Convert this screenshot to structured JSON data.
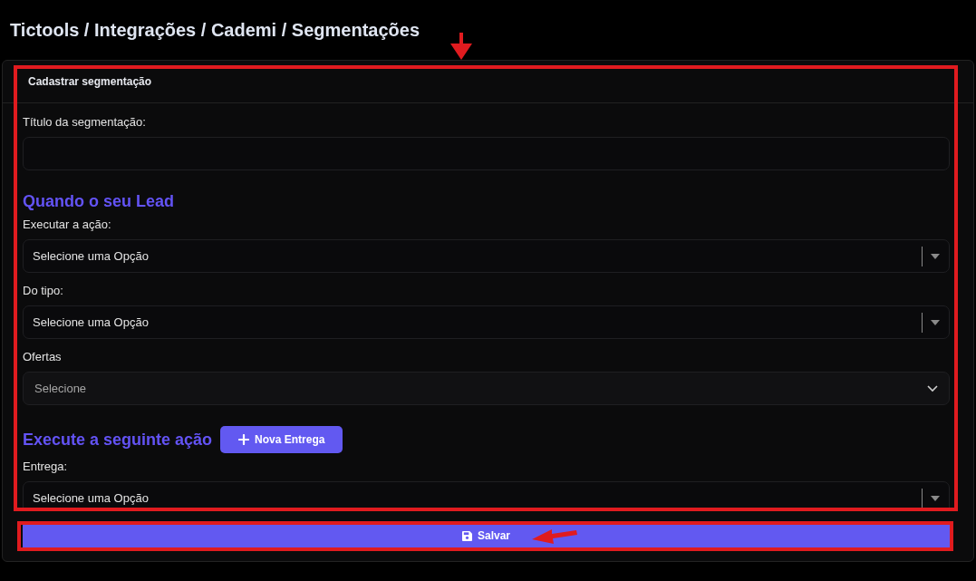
{
  "breadcrumb": "Tictools / Integrações / Cademi / Segmentações",
  "card": {
    "title": "Cadastrar segmentação"
  },
  "sections": [
    {
      "fields": [
        {
          "kind": "text",
          "label": "Título da segmentação:"
        }
      ]
    },
    {
      "heading": "Quando o seu Lead",
      "fields": [
        {
          "kind": "select",
          "label": "Executar a ação:",
          "value": "Selecione uma Opção"
        },
        {
          "kind": "select",
          "label": "Do tipo:",
          "value": "Selecione uma Opção"
        },
        {
          "kind": "multiselect",
          "label": "Ofertas",
          "placeholder": "Selecione"
        }
      ]
    },
    {
      "heading": "Execute a seguinte ação",
      "button": "Nova Entrega",
      "fields": [
        {
          "kind": "select",
          "label": "Entrega:",
          "value": "Selecione uma Opção"
        }
      ]
    }
  ],
  "save_button": "Salvar"
}
